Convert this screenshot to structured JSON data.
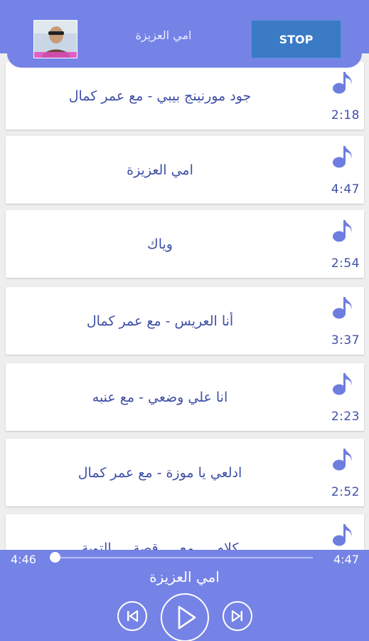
{
  "now_playing": {
    "title": "امي العزيزة",
    "stop_label": "STOP",
    "album_art_icon": "artist-photo"
  },
  "songs": [
    {
      "title": "جود مورنينج بيبي - مع عمر كمال",
      "duration": "2:18",
      "icon": "music-note-icon"
    },
    {
      "title": "امي العزيزة",
      "duration": "4:47",
      "icon": "music-note-icon"
    },
    {
      "title": "وياك",
      "duration": "2:54",
      "icon": "music-note-icon"
    },
    {
      "title": "أنا العريس - مع عمر كمال",
      "duration": "3:37",
      "icon": "music-note-icon"
    },
    {
      "title": "انا علي وضعي - مع عنبه",
      "duration": "2:23",
      "icon": "music-note-icon"
    },
    {
      "title": "ادلعي يا موزة - مع عمر كمال",
      "duration": "2:52",
      "icon": "music-note-icon"
    },
    {
      "title": "كلام ... مع ... قصة ... التوبة",
      "duration": "",
      "icon": "music-note-icon"
    }
  ],
  "player": {
    "current_time": "4:46",
    "total_time": "4:47",
    "progress": 0.0,
    "title": "امي العزيزة"
  },
  "colors": {
    "primary": "#7583e6",
    "text": "#3f4fa6",
    "note": "#6e7de0",
    "stop": "#3b7bc6"
  }
}
